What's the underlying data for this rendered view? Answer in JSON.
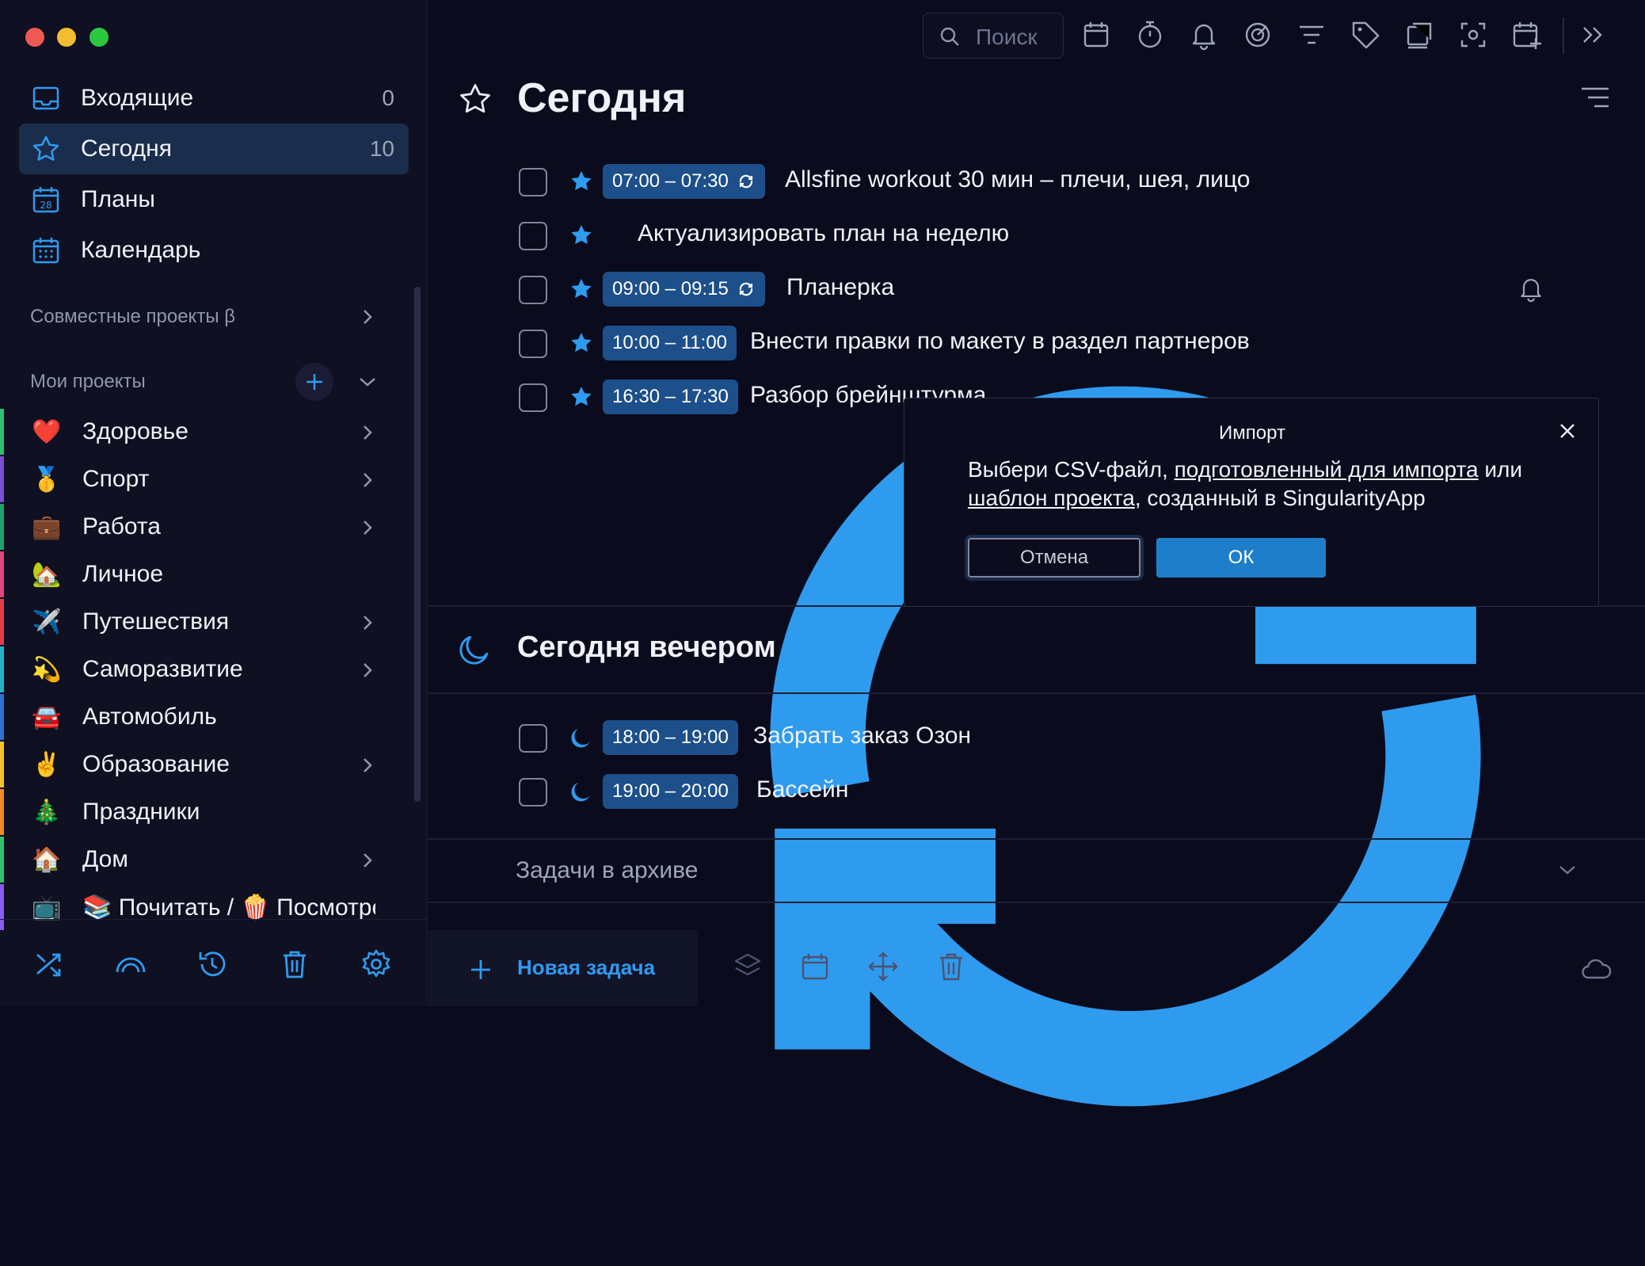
{
  "colors": {
    "accent": "#1e7ec9",
    "time_chip": "#1d4f8a",
    "active_nav": "#1b2d4c",
    "star": "#2f9bef"
  },
  "sidebar": {
    "nav": [
      {
        "label": "Входящие",
        "count": "0",
        "icon": "inbox-icon"
      },
      {
        "label": "Сегодня",
        "count": "10",
        "icon": "star-icon"
      },
      {
        "label": "Планы",
        "count": "",
        "icon": "calendar-28-icon"
      },
      {
        "label": "Календарь",
        "count": "",
        "icon": "calendar-grid-icon"
      }
    ],
    "shared_projects": "Совместные проекты β",
    "my_projects": "Мои проекты",
    "projects": [
      {
        "label": "Здоровье",
        "emoji": "❤️",
        "color": "#2fbf71",
        "has_children": true
      },
      {
        "label": "Спорт",
        "emoji": "🥇",
        "color": "#7b4fd6",
        "has_children": true
      },
      {
        "label": "Работа",
        "emoji": "💼",
        "color": "#22a06b",
        "has_children": true
      },
      {
        "label": "Личное",
        "emoji": "🏡",
        "color": "#e0457b",
        "has_children": false
      },
      {
        "label": "Путешествия",
        "emoji": "✈️",
        "color": "#e23b4a",
        "has_children": true
      },
      {
        "label": "Саморазвитие",
        "emoji": "💫",
        "color": "#22b3c7",
        "has_children": true
      },
      {
        "label": "Автомобиль",
        "emoji": "🚘",
        "color": "#2f6fd6",
        "has_children": false
      },
      {
        "label": "Образование",
        "emoji": "✌️",
        "color": "#f2c230",
        "has_children": true
      },
      {
        "label": "Праздники",
        "emoji": "🎄",
        "color": "#f08a24",
        "has_children": false
      },
      {
        "label": "Дом",
        "emoji": "🏠",
        "color": "#31c16b",
        "has_children": true
      },
      {
        "label": "📚 Почитать / 🍿 Посмотреть",
        "emoji": "📺",
        "color": "#8a5cf0",
        "has_children": false
      }
    ],
    "bottom_icons": [
      "shuffle-icon",
      "rainbow-icon",
      "history-icon",
      "trash-icon",
      "settings-icon"
    ]
  },
  "toolbar": {
    "search_placeholder": "Поиск",
    "icons": [
      "calendar-icon",
      "stopwatch-icon",
      "bell-icon",
      "target-icon",
      "filter-icon",
      "tag-icon",
      "card-icon",
      "focus-icon",
      "calendar-add-icon",
      "double-chevron-right-icon"
    ]
  },
  "today": {
    "title": "Сегодня",
    "tasks": [
      {
        "time": "07:00 – 07:30",
        "repeat": true,
        "title": "Allsfine workout 30 мин – плечи, шея, лицо"
      },
      {
        "time": "",
        "repeat": true,
        "title": "Актуализировать план на неделю"
      },
      {
        "time": "09:00 – 09:15",
        "repeat": true,
        "title": "Планерка",
        "bell": true
      },
      {
        "time": "10:00 – 11:00",
        "repeat": false,
        "title": "Внести правки по макету в раздел партнеров"
      },
      {
        "time": "16:30 – 17:30",
        "repeat": false,
        "title": "Разбор брейнштурма"
      }
    ]
  },
  "evening": {
    "title": "Сегодня вечером",
    "tasks": [
      {
        "time": "18:00 – 19:00",
        "title": "Забрать заказ Озон"
      },
      {
        "time": "19:00 – 20:00",
        "title": "Бассейн"
      }
    ]
  },
  "archive": {
    "label": "Задачи в архиве"
  },
  "footer": {
    "new_task": "Новая задача",
    "icons": [
      "layers-icon",
      "calendar-icon",
      "move-icon",
      "trash-icon",
      "cloud-icon"
    ]
  },
  "dialog": {
    "title": "Импорт",
    "text_1": "Выбери CSV-файл, ",
    "link_1": "подготовленный для импорта",
    "text_2": " или ",
    "link_2": "шаблон проекта",
    "text_3": ", созданный в SingularityApp",
    "cancel": "Отмена",
    "ok": "ОК"
  }
}
